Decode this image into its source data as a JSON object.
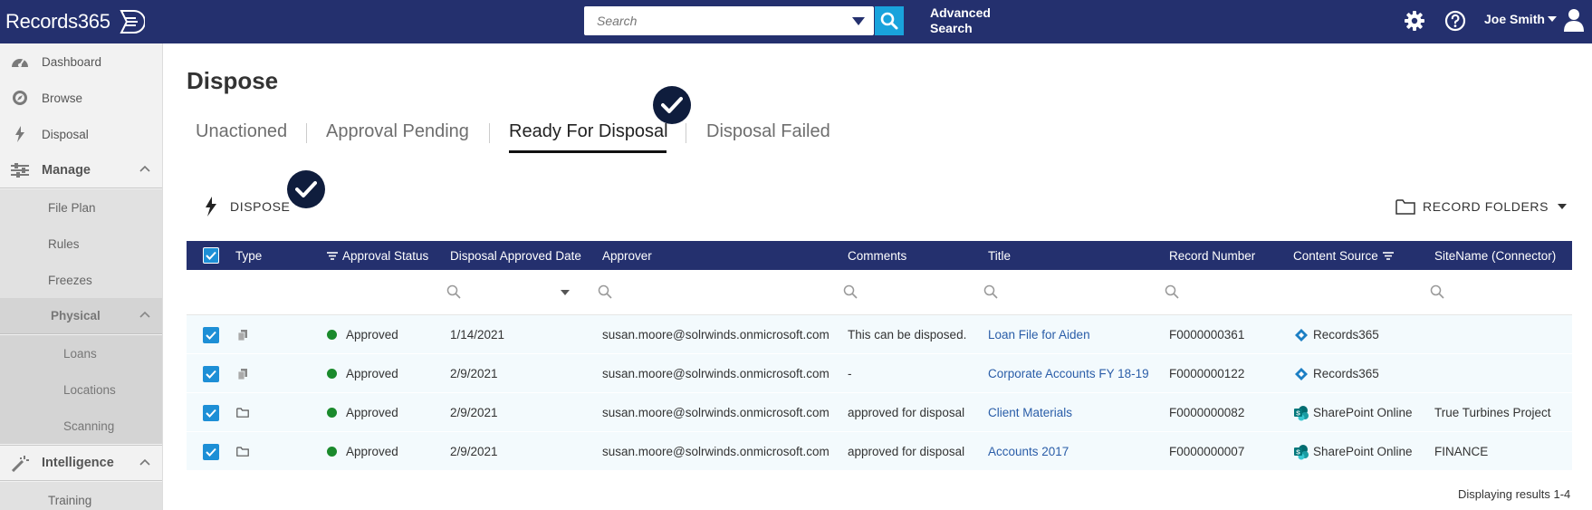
{
  "app": {
    "logo_text": "Records365",
    "search_placeholder": "Search",
    "advanced_search_line1": "Advanced",
    "advanced_search_line2": "Search",
    "user_name": "Joe Smith",
    "brand_color": "#24306e",
    "accent_color": "#19a3dc"
  },
  "sidebar": {
    "dashboard": "Dashboard",
    "browse": "Browse",
    "disposal": "Disposal",
    "manage": "Manage",
    "file_plan": "File Plan",
    "rules": "Rules",
    "freezes": "Freezes",
    "physical": "Physical",
    "loans": "Loans",
    "locations": "Locations",
    "scanning": "Scanning",
    "intelligence": "Intelligence",
    "training": "Training"
  },
  "page": {
    "title": "Dispose",
    "tabs": [
      "Unactioned",
      "Approval Pending",
      "Ready For Disposal",
      "Disposal Failed"
    ],
    "active_tab": "Ready For Disposal",
    "dispose_label": "DISPOSE",
    "record_folders_label": "RECORD FOLDERS",
    "results_text": "Displaying results 1-4"
  },
  "table": {
    "columns": [
      "Type",
      "Approval Status",
      "Disposal Approved Date",
      "Approver",
      "Comments",
      "Title",
      "Record Number",
      "Content Source",
      "SiteName (Connector)"
    ],
    "rows": [
      {
        "type_icon": "record-icon",
        "status": "Approved",
        "date": "1/14/2021",
        "approver": "susan.moore@solrwinds.onmicrosoft.com",
        "comments": "This can be disposed.",
        "title": "Loan File for Aiden",
        "record_number": "F0000000361",
        "source_icon": "records365-icon",
        "source": "Records365",
        "site": ""
      },
      {
        "type_icon": "record-icon",
        "status": "Approved",
        "date": "2/9/2021",
        "approver": "susan.moore@solrwinds.onmicrosoft.com",
        "comments": "-",
        "title": "Corporate Accounts FY 18-19",
        "record_number": "F0000000122",
        "source_icon": "records365-icon",
        "source": "Records365",
        "site": ""
      },
      {
        "type_icon": "folder-icon",
        "status": "Approved",
        "date": "2/9/2021",
        "approver": "susan.moore@solrwinds.onmicrosoft.com",
        "comments": "approved for disposal",
        "title": "Client Materials",
        "record_number": "F0000000082",
        "source_icon": "sharepoint-icon",
        "source": "SharePoint Online",
        "site": "True Turbines Project"
      },
      {
        "type_icon": "folder-icon",
        "status": "Approved",
        "date": "2/9/2021",
        "approver": "susan.moore@solrwinds.onmicrosoft.com",
        "comments": "approved for disposal",
        "title": "Accounts 2017",
        "record_number": "F0000000007",
        "source_icon": "sharepoint-icon",
        "source": "SharePoint Online",
        "site": "FINANCE"
      }
    ]
  }
}
